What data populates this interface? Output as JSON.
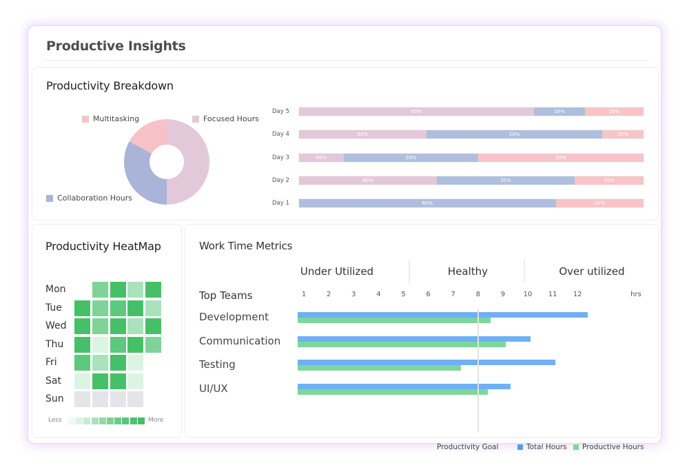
{
  "page": {
    "title": "Productive Insights"
  },
  "breakdown": {
    "title": "Productivity Breakdown"
  },
  "heatmap": {
    "title": "Productivity HeatMap",
    "days": [
      "Mon",
      "Tue",
      "Wed",
      "Thu",
      "Fri",
      "Sat",
      "Sun"
    ],
    "levels": [
      [
        null,
        2,
        4,
        1,
        4
      ],
      [
        4,
        2,
        3,
        4,
        1
      ],
      [
        4,
        2,
        4,
        1,
        4
      ],
      [
        4,
        0,
        3,
        4,
        2
      ],
      [
        3,
        1,
        4,
        0,
        null
      ],
      [
        0,
        4,
        4,
        0,
        null
      ],
      [
        -1,
        -1,
        -1,
        -1,
        null
      ]
    ],
    "legend_less": "Less",
    "legend_more": "More",
    "scale_colors": [
      "#effaf2",
      "#dcf3e3",
      "#c6ecd1",
      "#addfbd",
      "#95d8a8",
      "#7fd195",
      "#6ccc87",
      "#59c678",
      "#4cc36e",
      "#43bf66"
    ]
  },
  "metrics": {
    "title": "Work Time Metrics",
    "zones": [
      "Under Utilized",
      "Healthy",
      "Over utilized"
    ],
    "top_teams_label": "Top Teams"
  },
  "chart_data": [
    {
      "type": "pie",
      "title": "Productivity Breakdown",
      "donut": true,
      "labels": [
        "Focused Hours",
        "Collaboration Hours",
        "Multitasking"
      ],
      "values": [
        50,
        33,
        17
      ],
      "colors": [
        "#e3c8da",
        "#aab4d8",
        "#f7c2c7"
      ],
      "legend": [
        "Multitasking",
        "Focused Hours",
        "Collaboration Hours"
      ]
    },
    {
      "type": "bar",
      "orientation": "horizontal",
      "stacked": true,
      "categories": [
        "Day 5",
        "Day 4",
        "Day 3",
        "Day 2",
        "Day 1"
      ],
      "series": [
        {
          "name": "Focused Hours",
          "color": "#e3c8da",
          "values": [
            60,
            37,
            13,
            40,
            0
          ],
          "labels": [
            "60%",
            "60%",
            "60%",
            "60%",
            ""
          ]
        },
        {
          "name": "Collaboration Hours",
          "color": "#aebfde",
          "values": [
            13,
            51,
            39,
            40,
            79
          ],
          "labels": [
            "20%",
            "20%",
            "20%",
            "20%",
            "60%"
          ]
        },
        {
          "name": "Multitasking",
          "color": "#f8c4c8",
          "values": [
            15,
            12,
            48,
            20,
            27
          ],
          "labels": [
            "20%",
            "20%",
            "20%",
            "20%",
            "20%"
          ]
        }
      ]
    },
    {
      "type": "bar",
      "orientation": "horizontal",
      "title": "Work Time Metrics",
      "categories": [
        "Development",
        "Communication",
        "Testing",
        "UI/UX"
      ],
      "series": [
        {
          "name": "Total Hours",
          "color": "#6fb0f5",
          "values": [
            12.4,
            10.1,
            11.1,
            9.3
          ]
        },
        {
          "name": "Productive Hours",
          "color": "#7ed79a",
          "values": [
            8.5,
            9.1,
            7.3,
            8.4
          ]
        }
      ],
      "xticks": [
        "1",
        "2",
        "3",
        "4",
        "5",
        "6",
        "7",
        "8",
        "9",
        "10",
        "11",
        "12"
      ],
      "xlabel": "hrs",
      "xlim": [
        0,
        13.5
      ],
      "goal": {
        "label": "Productivity Goal",
        "value": 8
      },
      "legend": [
        "Productivity Goal",
        "Total Hours",
        "Productive Hours"
      ],
      "legend_placement": "bottom-right"
    }
  ]
}
